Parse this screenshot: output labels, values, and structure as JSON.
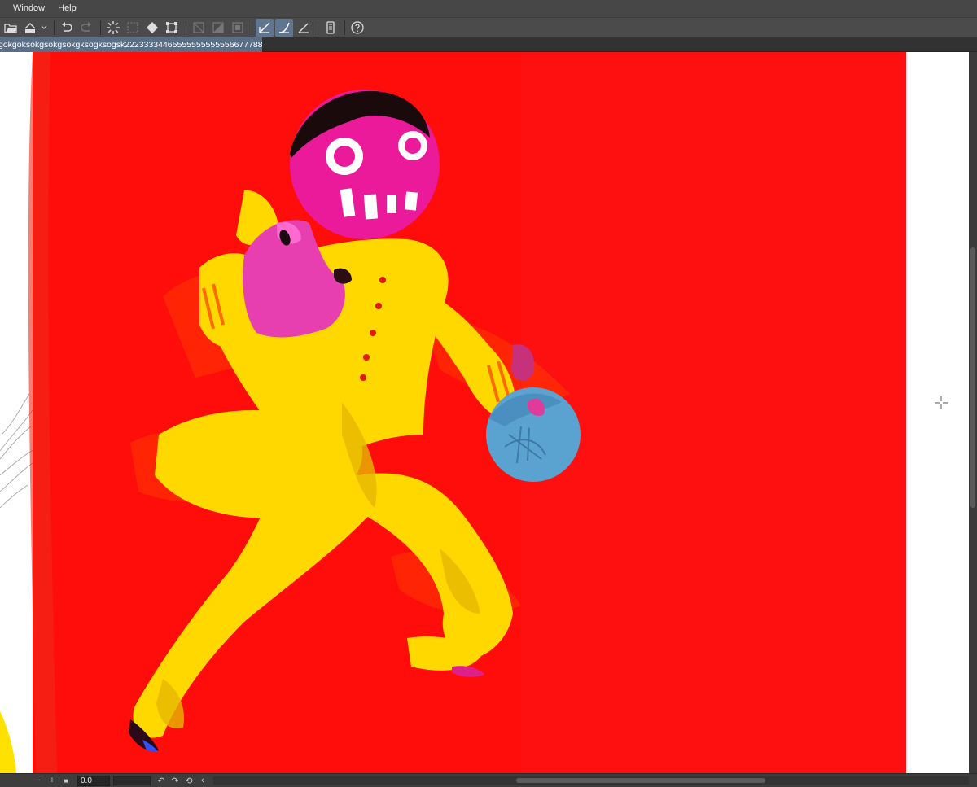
{
  "menubar": {
    "items": [
      {
        "label": "Window"
      },
      {
        "label": "Help"
      }
    ]
  },
  "toolbar": {
    "buttons": [
      {
        "icon": "open-file-icon"
      },
      {
        "icon": "save-icon"
      },
      {
        "icon": "undo-icon"
      },
      {
        "icon": "redo-icon"
      },
      {
        "icon": "loading-spinner-icon"
      },
      {
        "icon": "clear-selection-icon"
      },
      {
        "icon": "fill-icon"
      },
      {
        "icon": "transform-icon"
      },
      {
        "icon": "hide-selection-icon"
      },
      {
        "icon": "invert-selection-icon"
      },
      {
        "icon": "selection-border-icon"
      },
      {
        "icon": "snap-ruler-icon"
      },
      {
        "icon": "snap-special-ruler-icon"
      },
      {
        "icon": "snap-grid-icon"
      },
      {
        "icon": "device-icon"
      },
      {
        "icon": "help-icon"
      }
    ]
  },
  "document_tab": {
    "title": "gokgoksokgsokgsokgksogksogsk22233334465555555555556677788*",
    "close_symbol": "●"
  },
  "statusbar": {
    "zoom_out": "−",
    "zoom_in": "+",
    "fit": "■",
    "rotation_value": "0.0",
    "rotate_left": "↶",
    "rotate_right": "↷",
    "reset": "⟲",
    "scroll_left": "‹"
  },
  "colors": {
    "canvas_red": "#ff1010",
    "figure_yellow": "#ffd800",
    "head_magenta": "#ef1fa0",
    "ball_blue": "#5aa2d0",
    "tab_active": "#5a6e86",
    "toolbar_active": "#5f7590"
  }
}
